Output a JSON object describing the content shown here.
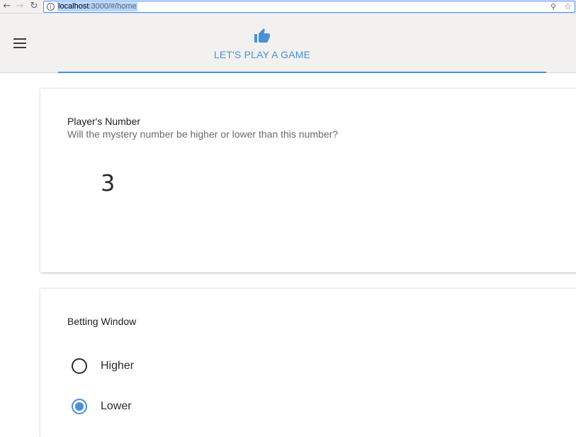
{
  "browser": {
    "url_host": "localhost",
    "url_path": ":3000/#/home"
  },
  "appbar": {
    "tab_label": "LET'S PLAY A GAME",
    "accent_color": "#4a90d9"
  },
  "player_card": {
    "title": "Player's Number",
    "subtitle": "Will the mystery number be higher or lower than this number?",
    "number": "3"
  },
  "betting_card": {
    "title": "Betting Window",
    "options": [
      {
        "label": "Higher",
        "selected": false
      },
      {
        "label": "Lower",
        "selected": true
      }
    ]
  },
  "icons": {
    "menu": "hamburger-menu-icon",
    "tab": "thumbs-up-icon"
  }
}
